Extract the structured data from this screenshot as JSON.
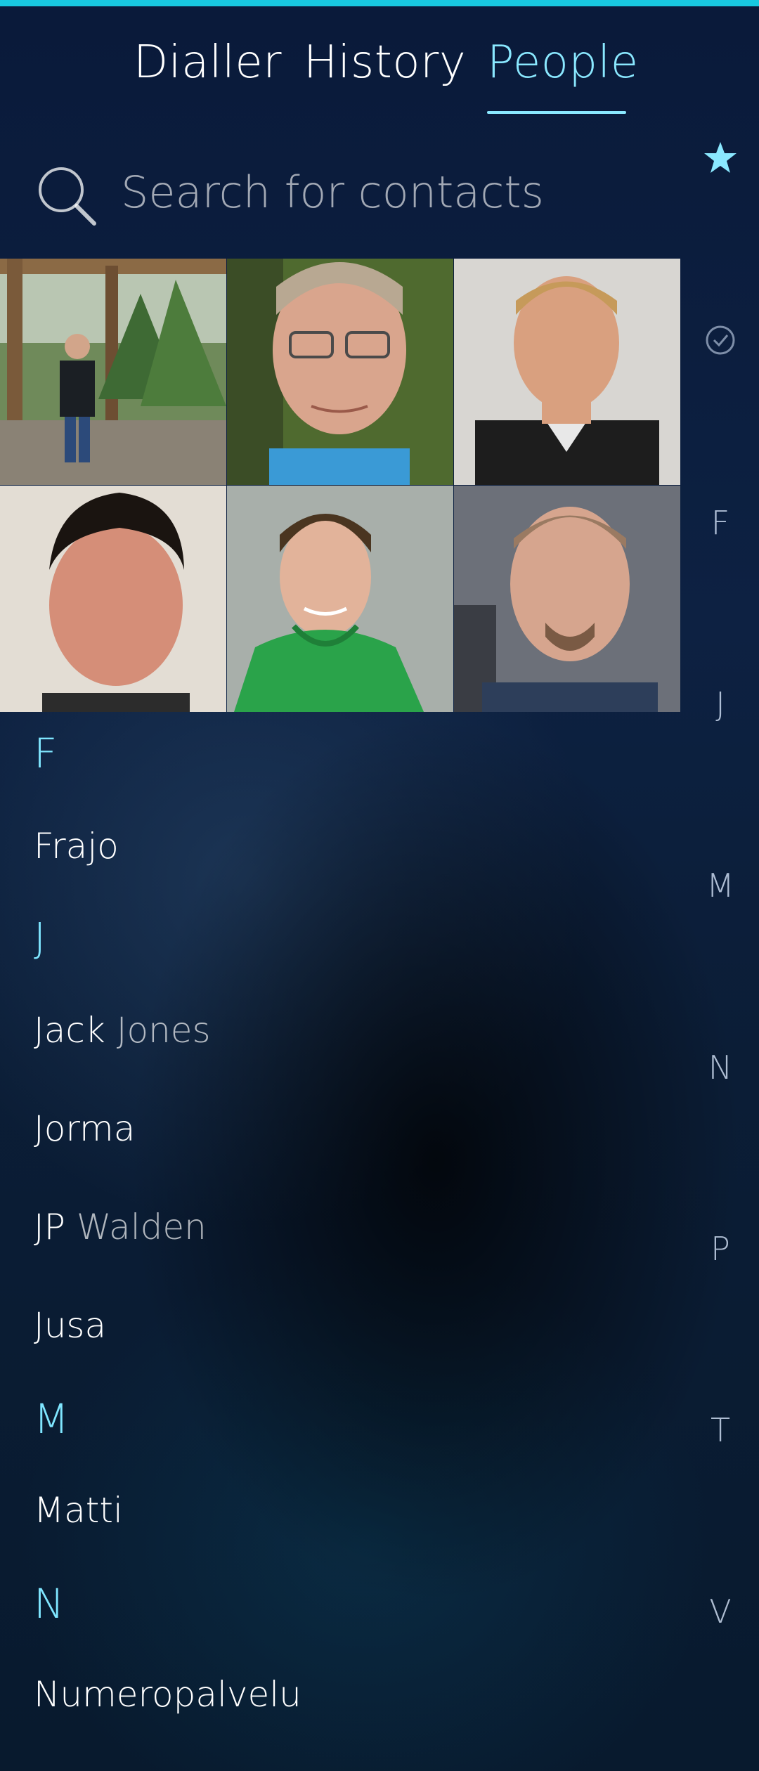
{
  "colors": {
    "accent": "#8ae8ff",
    "topbar": "#18c8e0"
  },
  "tabs": [
    {
      "label": "Dialler"
    },
    {
      "label": "History"
    },
    {
      "label": "People",
      "active": true
    }
  ],
  "search": {
    "placeholder": "Search for contacts",
    "icon": "search-icon"
  },
  "favorites": [
    {
      "icon": "avatar-outdoor-man"
    },
    {
      "icon": "avatar-glasses-man"
    },
    {
      "icon": "avatar-blond-man"
    },
    {
      "icon": "avatar-darkhair-man"
    },
    {
      "icon": "avatar-green-hoodie-man"
    },
    {
      "icon": "avatar-bald-man"
    }
  ],
  "sections": [
    {
      "letter": "F",
      "contacts": [
        {
          "first": "Frajo",
          "last": ""
        }
      ]
    },
    {
      "letter": "J",
      "contacts": [
        {
          "first": "Jack",
          "last": "Jones"
        },
        {
          "first": "Jorma",
          "last": ""
        },
        {
          "first": "JP",
          "last": "Walden"
        },
        {
          "first": "Jusa",
          "last": ""
        }
      ]
    },
    {
      "letter": "M",
      "contacts": [
        {
          "first": "Matti",
          "last": ""
        }
      ]
    },
    {
      "letter": "N",
      "contacts": [
        {
          "first": "Numeropalvelu",
          "last": ""
        }
      ]
    }
  ],
  "index": {
    "icons": [
      "star-icon",
      "check-circle-icon"
    ],
    "letters": [
      "F",
      "J",
      "M",
      "N",
      "P",
      "T",
      "V"
    ]
  }
}
